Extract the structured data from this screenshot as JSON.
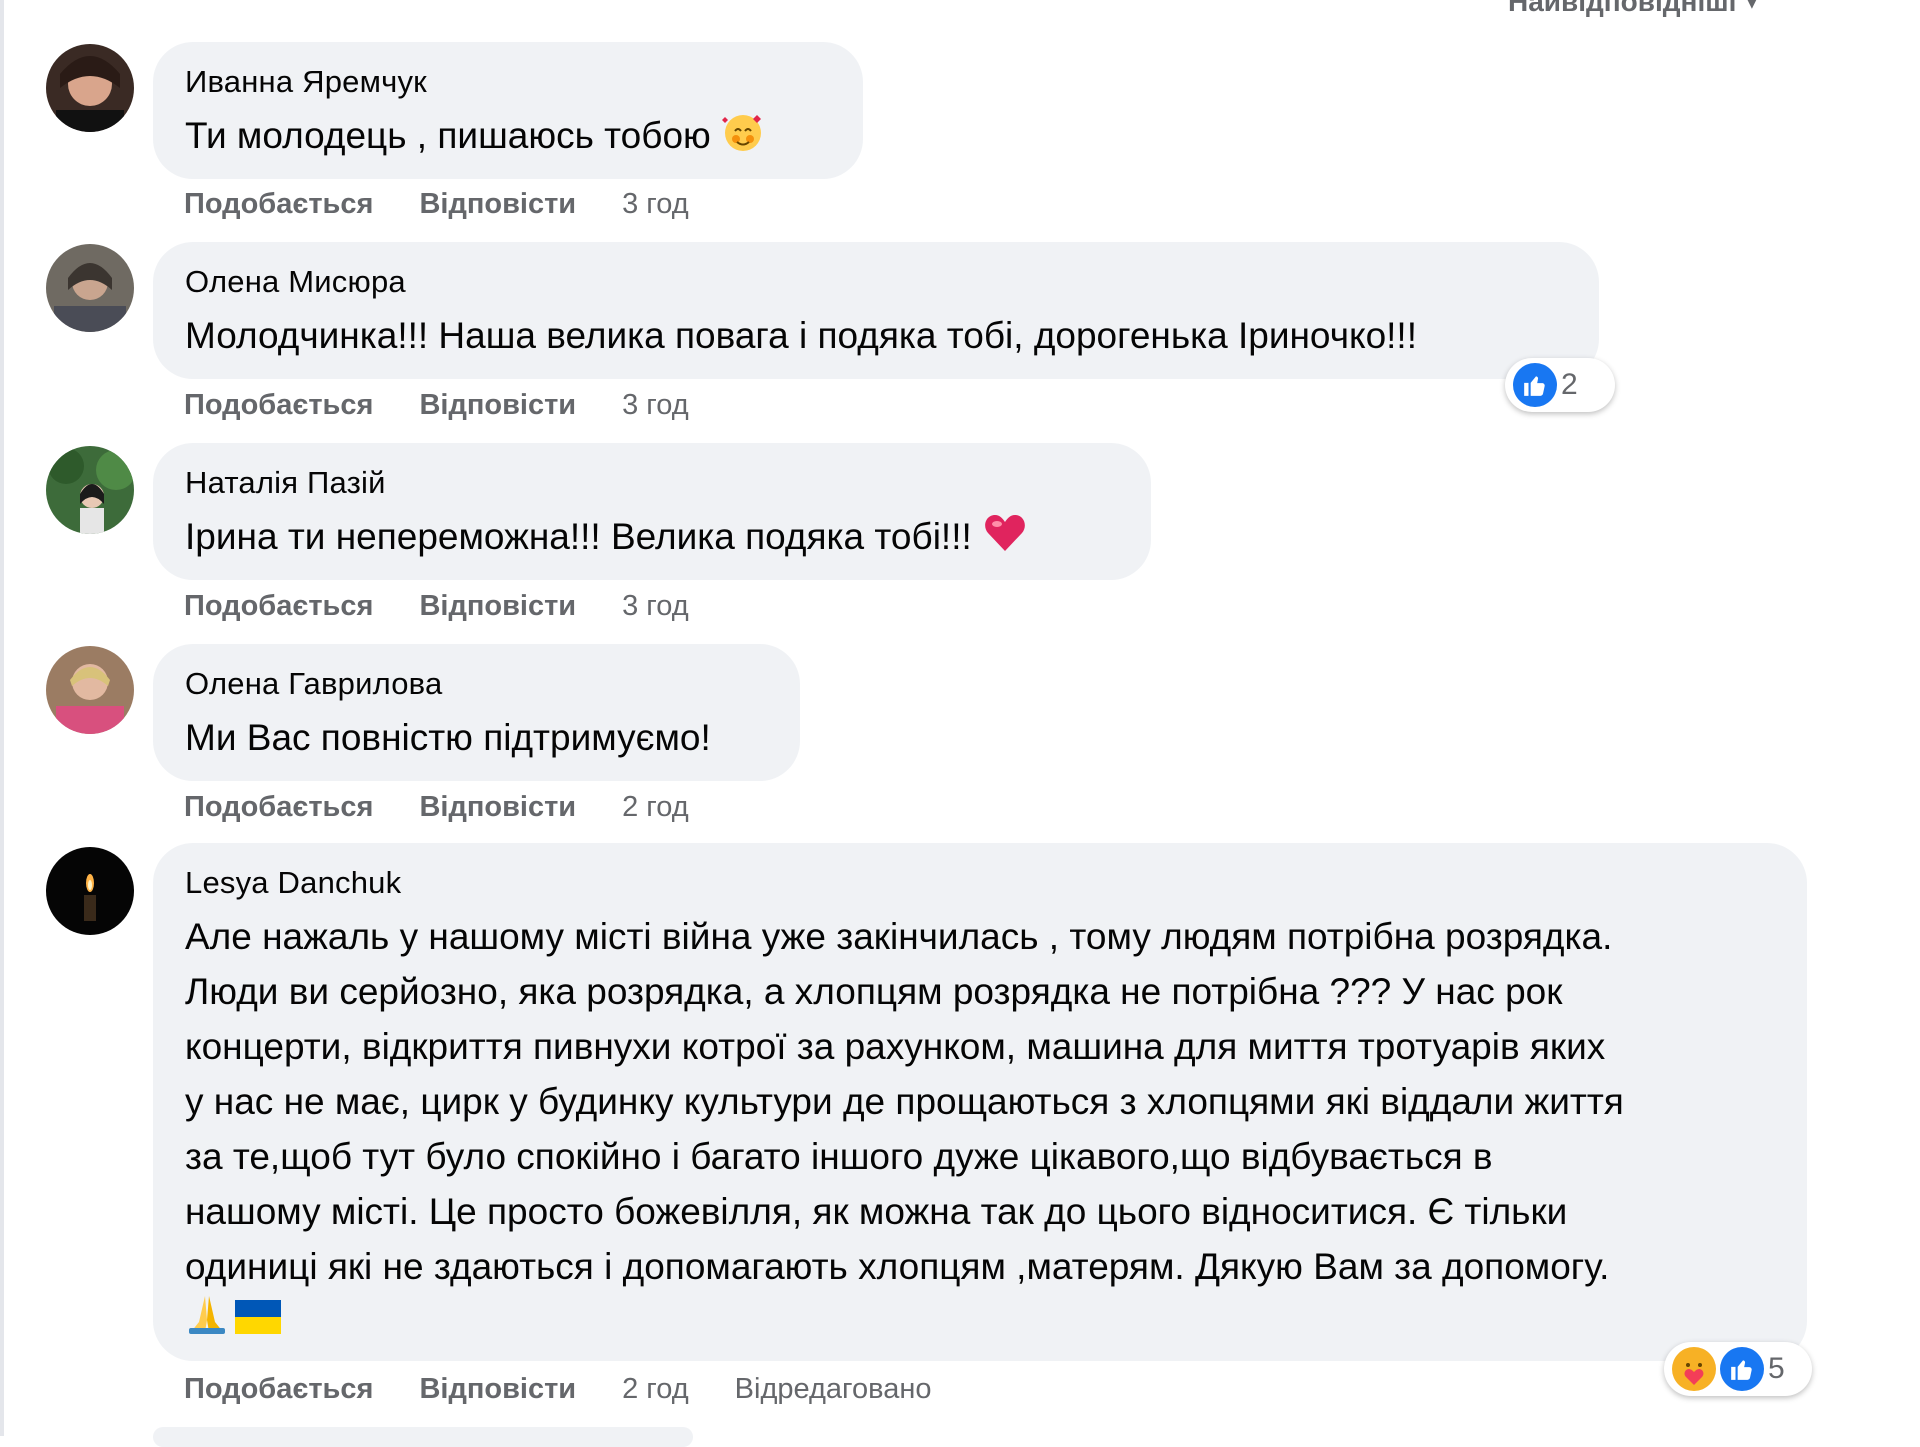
{
  "sort_label": "Найвідповідніші",
  "comments": [
    {
      "author": "Иванна Яремчук",
      "text": "Ти молодець , пишаюсь тобою",
      "emoji": "smiling-face-with-hearts",
      "actions": {
        "like": "Подобається",
        "reply": "Відповісти",
        "time": "3 год"
      }
    },
    {
      "author": "Олена Мисюра",
      "text": "Молодчинка!!! Наша велика повага і подяка тобі, дорогенька Іриночко!!!",
      "actions": {
        "like": "Подобається",
        "reply": "Відповісти",
        "time": "3 год"
      },
      "reactions": {
        "icons": [
          "like-reaction-icon"
        ],
        "count": "2"
      }
    },
    {
      "author": "Наталія Пазій",
      "text": "Ірина ти непереможна!!! Велика подяка тобі!!!",
      "emoji": "heart",
      "actions": {
        "like": "Подобається",
        "reply": "Відповісти",
        "time": "3 год"
      }
    },
    {
      "author": "Олена Гаврилова",
      "text": "Ми Вас повністю підтримуємо!",
      "actions": {
        "like": "Подобається",
        "reply": "Відповісти",
        "time": "2 год"
      }
    },
    {
      "author": "Lesya Danchuk",
      "text_lines": [
        "Але нажаль у нашому місті війна уже закінчилась , тому людям потрібна розрядка.",
        "Люди ви серйозно, яка розрядка, а хлопцям розрядка не потрібна ??? У нас рок",
        "концерти, відкриття пивнухи котрої за рахунком, машина для миття тротуарів яких",
        "у нас не має, цирк у будинку культури де прощаються з хлопцями які віддали життя",
        "за те,щоб тут було спокійно і багато іншого дуже цікавого,що відбувається в",
        "нашому місті. Це просто божевілля, як можна так до цього відноситися. Є тільки",
        "одиниці які не здаються і допомагають хлопцям ,матерям. Дякую Вам за допомогу."
      ],
      "emojis": [
        "praying-hands",
        "ukraine-flag"
      ],
      "actions": {
        "like": "Подобається",
        "reply": "Відповісти",
        "time": "2 год",
        "edited": "Відредаговано"
      },
      "reactions": {
        "icons": [
          "care-reaction-icon",
          "like-reaction-icon"
        ],
        "count": "5"
      }
    }
  ],
  "colors": {
    "bubble": "#f0f2f5",
    "meta": "#65676b",
    "like_blue": "#1877f2",
    "heart_red": "#f33e58"
  }
}
